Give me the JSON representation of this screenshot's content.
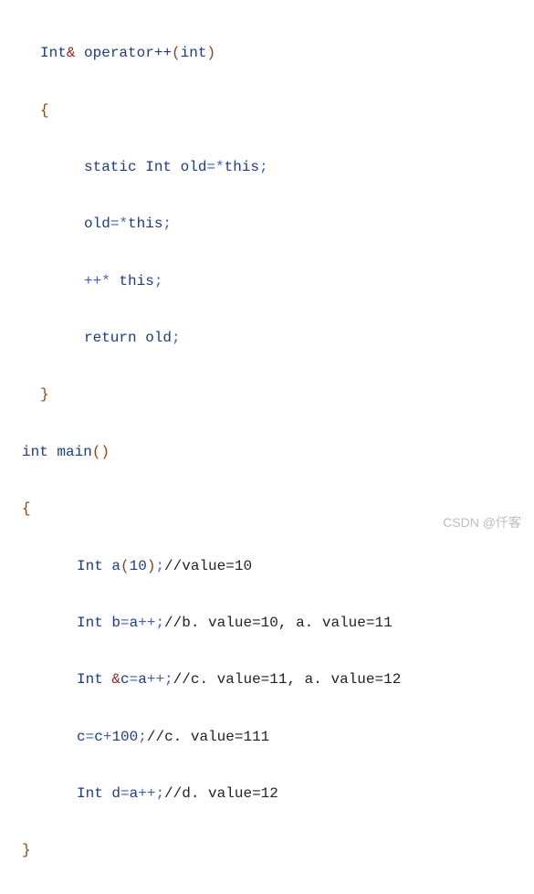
{
  "code": {
    "l01_a": "Int",
    "l01_b": "&",
    "l01_c": " operator++",
    "l01_d": "(",
    "l01_e": "int",
    "l01_f": ")",
    "l02": "{",
    "l03_a": "static Int old",
    "l03_b": "=*",
    "l03_c": "this",
    "l03_d": ";",
    "l04_a": "old",
    "l04_b": "=*",
    "l04_c": "this",
    "l04_d": ";",
    "l05_a": "++*",
    "l05_b": " this",
    "l05_c": ";",
    "l06_a": "return old",
    "l06_b": ";",
    "l07": "}",
    "l08_a": "int main",
    "l08_b": "()",
    "l09": "{",
    "l10_a": "Int a",
    "l10_b": "(",
    "l10_c": "10",
    "l10_d": ")",
    "l10_e": ";",
    "l10_f": "//value=10",
    "l11_a": "Int b",
    "l11_b": "=",
    "l11_c": "a",
    "l11_d": "++;",
    "l11_e": "//b. value=10, a. value=11",
    "l12_a": "Int ",
    "l12_b": "&",
    "l12_c": "c",
    "l12_d": "=",
    "l12_e": "a",
    "l12_f": "++;",
    "l12_g": "//c. value=11, a. value=12",
    "l13_a": "c",
    "l13_b": "=",
    "l13_c": "c",
    "l13_d": "+",
    "l13_e": "100",
    "l13_f": ";",
    "l13_g": "//c. value=111",
    "l14_a": "Int d",
    "l14_b": "=",
    "l14_c": "a",
    "l14_d": "++;",
    "l14_e": "//d. value=12",
    "l15": "}"
  },
  "watermark": "CSDN @仟客"
}
